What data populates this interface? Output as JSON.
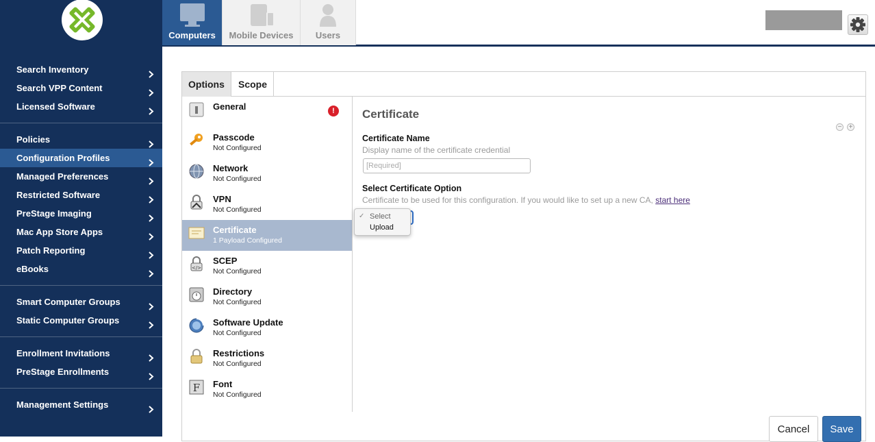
{
  "sidebar": {
    "logo_icon": "jamf-cross-logo",
    "groups": [
      [
        "Search Inventory",
        "Search VPP Content",
        "Licensed Software"
      ],
      [
        "Policies",
        "Configuration Profiles",
        "Managed Preferences",
        "Restricted Software",
        "PreStage Imaging",
        "Mac App Store Apps",
        "Patch Reporting",
        "eBooks"
      ],
      [
        "Smart Computer Groups",
        "Static Computer Groups"
      ],
      [
        "Enrollment Invitations",
        "PreStage Enrollments"
      ],
      [
        "Management Settings"
      ]
    ],
    "active_item": "Configuration Profiles"
  },
  "top_tabs": [
    {
      "label": "Computers",
      "icon": "monitor-icon",
      "active": true
    },
    {
      "label": "Mobile Devices",
      "icon": "mobile-devices-icon",
      "active": false
    },
    {
      "label": "Users",
      "icon": "user-icon",
      "active": false
    }
  ],
  "header": {
    "settings_icon": "gear-icon"
  },
  "panel_tabs": [
    {
      "label": "Options",
      "active": true
    },
    {
      "label": "Scope",
      "active": false
    }
  ],
  "payloads": [
    {
      "title": "General",
      "status": "",
      "icon": "general-icon",
      "badge": "!"
    },
    {
      "title": "Passcode",
      "status": "Not Configured",
      "icon": "key-icon"
    },
    {
      "title": "Network",
      "status": "Not Configured",
      "icon": "globe-icon"
    },
    {
      "title": "VPN",
      "status": "Not Configured",
      "icon": "vpn-lock-icon"
    },
    {
      "title": "Certificate",
      "status": "1 Payload Configured",
      "icon": "certificate-icon",
      "selected": true
    },
    {
      "title": "SCEP",
      "status": "Not Configured",
      "icon": "scep-lock-icon"
    },
    {
      "title": "Directory",
      "status": "Not Configured",
      "icon": "directory-icon"
    },
    {
      "title": "Software Update",
      "status": "Not Configured",
      "icon": "software-update-icon"
    },
    {
      "title": "Restrictions",
      "status": "Not Configured",
      "icon": "restrictions-lock-icon"
    },
    {
      "title": "Font",
      "status": "Not Configured",
      "icon": "font-icon"
    }
  ],
  "editor": {
    "title": "Certificate",
    "cert_name_label": "Certificate Name",
    "cert_name_help": "Display name of the certificate credential",
    "cert_name_placeholder": "[Required]",
    "cert_option_label": "Select Certificate Option",
    "cert_option_help": "Certificate to be used for this configuration. If you would like to set up a new CA,",
    "cert_option_link": "start here",
    "options": [
      "Select",
      "Upload"
    ],
    "selected_option": "Select",
    "minus_symbol": "−",
    "plus_symbol": "+"
  },
  "footer": {
    "cancel_label": "Cancel",
    "save_label": "Save"
  },
  "colors": {
    "sidebar_bg": "#14305a",
    "active_bg": "#2b5a93",
    "selected_row": "#a8b8cf",
    "save_bg": "#336fb0",
    "badge": "#d9202a"
  }
}
